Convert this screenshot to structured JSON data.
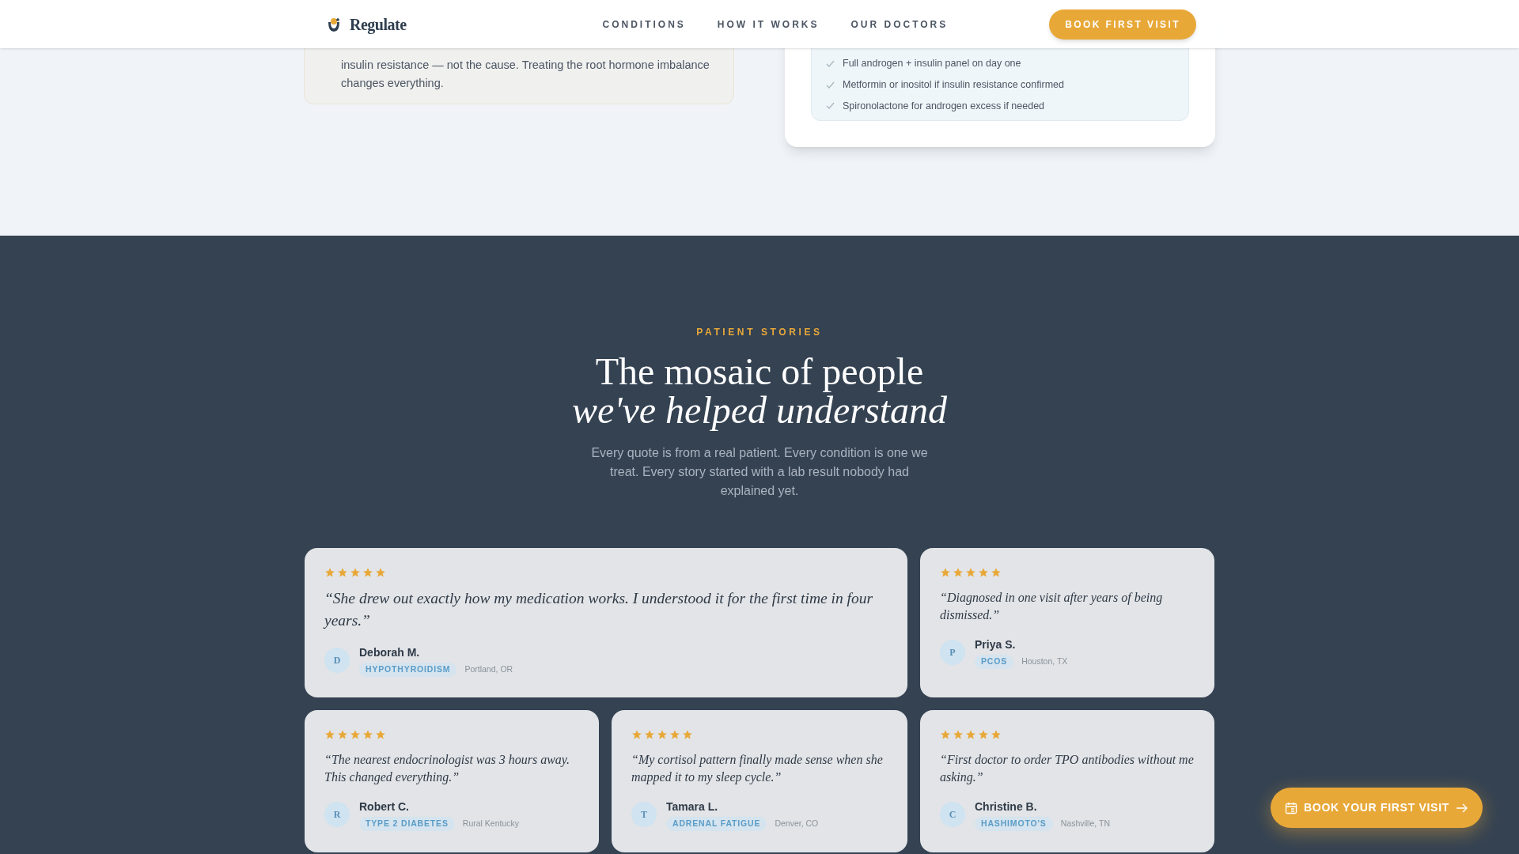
{
  "header": {
    "brand": "Regulate",
    "nav": [
      {
        "label": "CONDITIONS"
      },
      {
        "label": "HOW IT WORKS"
      },
      {
        "label": "OUR DOCTORS"
      }
    ],
    "cta": "BOOK FIRST VISIT"
  },
  "insight_card": {
    "text": "insulin resistance — not the cause. Treating the root hormone imbalance changes everything."
  },
  "plan_card": {
    "items": [
      "Full androgen + insulin panel on day one",
      "Metformin or inositol if insulin resistance confirmed",
      "Spironolactone for androgen excess if needed"
    ]
  },
  "stories": {
    "eyebrow": "PATIENT STORIES",
    "title_line1": "The mosaic of people",
    "title_line2": "we've helped understand",
    "intro": "Every quote is from a real patient. Every condition is one we treat. Every story started with a lab result nobody had explained yet.",
    "testimonials": [
      {
        "stars": 5,
        "quote": "“She drew out exactly how my medication works. I understood it for the first time in four years.”",
        "initial": "D",
        "name": "Deborah M.",
        "condition": "HYPOTHYROIDISM",
        "location": "Portland, OR",
        "wide": true
      },
      {
        "stars": 5,
        "quote": "“Diagnosed in one visit after years of being dismissed.”",
        "initial": "P",
        "name": "Priya S.",
        "condition": "PCOS",
        "location": "Houston, TX",
        "wide": false
      },
      {
        "stars": 5,
        "quote": "“The nearest endocrinologist was 3 hours away. This changed everything.”",
        "initial": "R",
        "name": "Robert C.",
        "condition": "TYPE 2 DIABETES",
        "location": "Rural Kentucky",
        "wide": false
      },
      {
        "stars": 5,
        "quote": "“My cortisol pattern finally made sense when she mapped it to my sleep cycle.”",
        "initial": "T",
        "name": "Tamara L.",
        "condition": "ADRENAL FATIGUE",
        "location": "Denver, CO",
        "wide": false
      },
      {
        "stars": 5,
        "quote": "“First doctor to order TPO antibodies without me asking.”",
        "initial": "C",
        "name": "Christine B.",
        "condition": "HASHIMOTO'S",
        "location": "Nashville, TN",
        "wide": false
      }
    ]
  },
  "floating_cta": {
    "label": "BOOK YOUR FIRST VISIT"
  }
}
